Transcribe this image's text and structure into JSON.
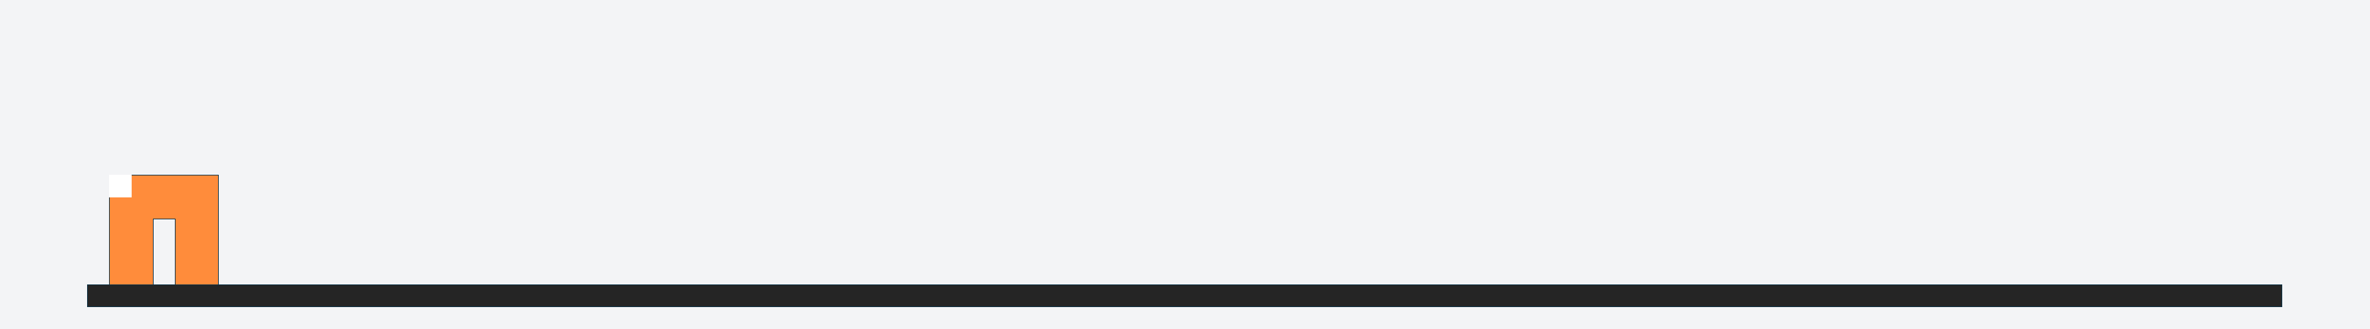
{
  "scene": {
    "background_color": "#f3f4f6",
    "ground": {
      "name": "platform",
      "color": "#252525",
      "outline": "#0d3347"
    },
    "building": {
      "name": "house",
      "color": "#ff8c3b",
      "outline": "#0d3347"
    },
    "window": {
      "name": "window",
      "color": "#ffffff"
    },
    "door": {
      "name": "door-opening",
      "color": "#f3f4f6"
    }
  }
}
